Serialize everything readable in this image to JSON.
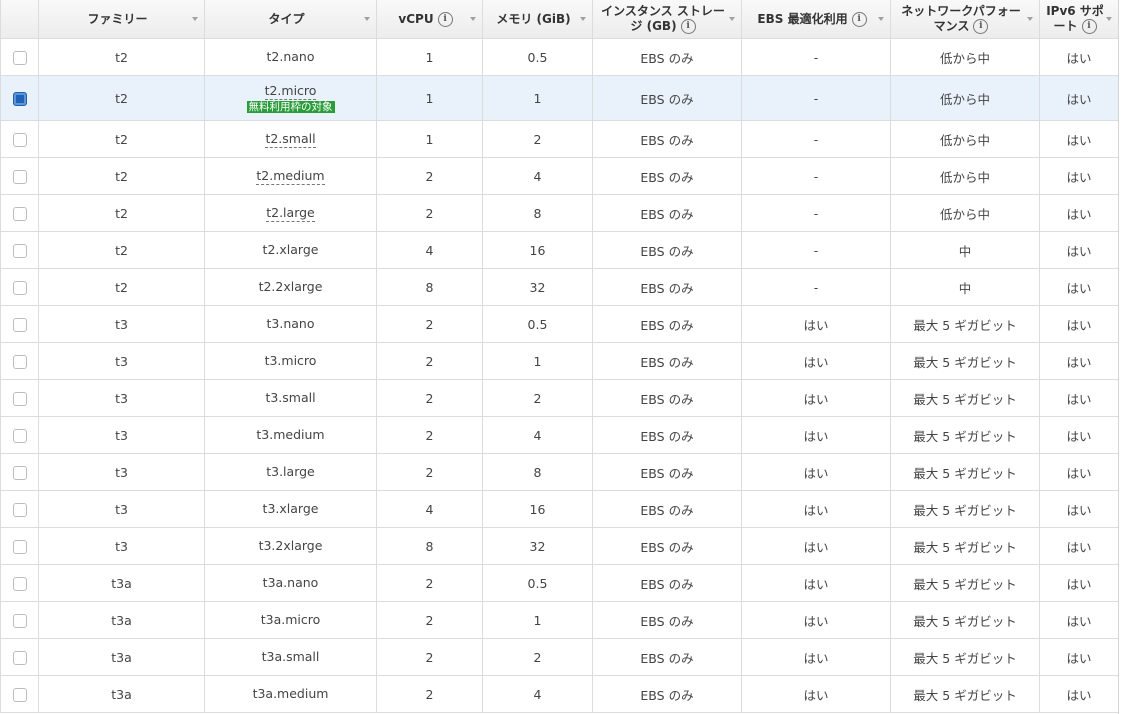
{
  "columns": [
    {
      "label": "ファミリー",
      "info": false
    },
    {
      "label": "タイプ",
      "info": false
    },
    {
      "label": "vCPU",
      "info": true
    },
    {
      "label": "メモリ (GiB)",
      "info": false
    },
    {
      "label": "インスタンス ストレージ (GB)",
      "info": true
    },
    {
      "label": "EBS 最適化利用",
      "info": true
    },
    {
      "label": "ネットワークパフォーマンス",
      "info": true
    },
    {
      "label": "IPv6 サポート",
      "info": true
    }
  ],
  "header_lines": {
    "storage_1": "インスタンス ストレー",
    "storage_2": "ジ (GB)",
    "network_1": "ネットワークパフォー",
    "network_2": "マンス",
    "ipv6_1": "IPv6 サポ",
    "ipv6_2": "ート"
  },
  "info_icon": "info-icon",
  "free_tier_label": "無料利用枠の対象",
  "rows": [
    {
      "family": "t2",
      "type": "t2.nano",
      "vcpu": "1",
      "memory": "0.5",
      "storage": "EBS のみ",
      "ebs_opt": "-",
      "network": "低から中",
      "ipv6": "はい",
      "checked": false,
      "underline": false
    },
    {
      "family": "t2",
      "type": "t2.micro",
      "vcpu": "1",
      "memory": "1",
      "storage": "EBS のみ",
      "ebs_opt": "-",
      "network": "低から中",
      "ipv6": "はい",
      "checked": true,
      "underline": true,
      "free_tier": true
    },
    {
      "family": "t2",
      "type": "t2.small",
      "vcpu": "1",
      "memory": "2",
      "storage": "EBS のみ",
      "ebs_opt": "-",
      "network": "低から中",
      "ipv6": "はい",
      "checked": false,
      "underline": true
    },
    {
      "family": "t2",
      "type": "t2.medium",
      "vcpu": "2",
      "memory": "4",
      "storage": "EBS のみ",
      "ebs_opt": "-",
      "network": "低から中",
      "ipv6": "はい",
      "checked": false,
      "underline": true
    },
    {
      "family": "t2",
      "type": "t2.large",
      "vcpu": "2",
      "memory": "8",
      "storage": "EBS のみ",
      "ebs_opt": "-",
      "network": "低から中",
      "ipv6": "はい",
      "checked": false,
      "underline": true
    },
    {
      "family": "t2",
      "type": "t2.xlarge",
      "vcpu": "4",
      "memory": "16",
      "storage": "EBS のみ",
      "ebs_opt": "-",
      "network": "中",
      "ipv6": "はい",
      "checked": false,
      "underline": false
    },
    {
      "family": "t2",
      "type": "t2.2xlarge",
      "vcpu": "8",
      "memory": "32",
      "storage": "EBS のみ",
      "ebs_opt": "-",
      "network": "中",
      "ipv6": "はい",
      "checked": false,
      "underline": false
    },
    {
      "family": "t3",
      "type": "t3.nano",
      "vcpu": "2",
      "memory": "0.5",
      "storage": "EBS のみ",
      "ebs_opt": "はい",
      "network": "最大 5 ギガビット",
      "ipv6": "はい",
      "checked": false,
      "underline": false
    },
    {
      "family": "t3",
      "type": "t3.micro",
      "vcpu": "2",
      "memory": "1",
      "storage": "EBS のみ",
      "ebs_opt": "はい",
      "network": "最大 5 ギガビット",
      "ipv6": "はい",
      "checked": false,
      "underline": false
    },
    {
      "family": "t3",
      "type": "t3.small",
      "vcpu": "2",
      "memory": "2",
      "storage": "EBS のみ",
      "ebs_opt": "はい",
      "network": "最大 5 ギガビット",
      "ipv6": "はい",
      "checked": false,
      "underline": false
    },
    {
      "family": "t3",
      "type": "t3.medium",
      "vcpu": "2",
      "memory": "4",
      "storage": "EBS のみ",
      "ebs_opt": "はい",
      "network": "最大 5 ギガビット",
      "ipv6": "はい",
      "checked": false,
      "underline": false
    },
    {
      "family": "t3",
      "type": "t3.large",
      "vcpu": "2",
      "memory": "8",
      "storage": "EBS のみ",
      "ebs_opt": "はい",
      "network": "最大 5 ギガビット",
      "ipv6": "はい",
      "checked": false,
      "underline": false
    },
    {
      "family": "t3",
      "type": "t3.xlarge",
      "vcpu": "4",
      "memory": "16",
      "storage": "EBS のみ",
      "ebs_opt": "はい",
      "network": "最大 5 ギガビット",
      "ipv6": "はい",
      "checked": false,
      "underline": false
    },
    {
      "family": "t3",
      "type": "t3.2xlarge",
      "vcpu": "8",
      "memory": "32",
      "storage": "EBS のみ",
      "ebs_opt": "はい",
      "network": "最大 5 ギガビット",
      "ipv6": "はい",
      "checked": false,
      "underline": false
    },
    {
      "family": "t3a",
      "type": "t3a.nano",
      "vcpu": "2",
      "memory": "0.5",
      "storage": "EBS のみ",
      "ebs_opt": "はい",
      "network": "最大 5 ギガビット",
      "ipv6": "はい",
      "checked": false,
      "underline": false
    },
    {
      "family": "t3a",
      "type": "t3a.micro",
      "vcpu": "2",
      "memory": "1",
      "storage": "EBS のみ",
      "ebs_opt": "はい",
      "network": "最大 5 ギガビット",
      "ipv6": "はい",
      "checked": false,
      "underline": false
    },
    {
      "family": "t3a",
      "type": "t3a.small",
      "vcpu": "2",
      "memory": "2",
      "storage": "EBS のみ",
      "ebs_opt": "はい",
      "network": "最大 5 ギガビット",
      "ipv6": "はい",
      "checked": false,
      "underline": false
    },
    {
      "family": "t3a",
      "type": "t3a.medium",
      "vcpu": "2",
      "memory": "4",
      "storage": "EBS のみ",
      "ebs_opt": "はい",
      "network": "最大 5 ギガビット",
      "ipv6": "はい",
      "checked": false,
      "underline": false
    }
  ]
}
